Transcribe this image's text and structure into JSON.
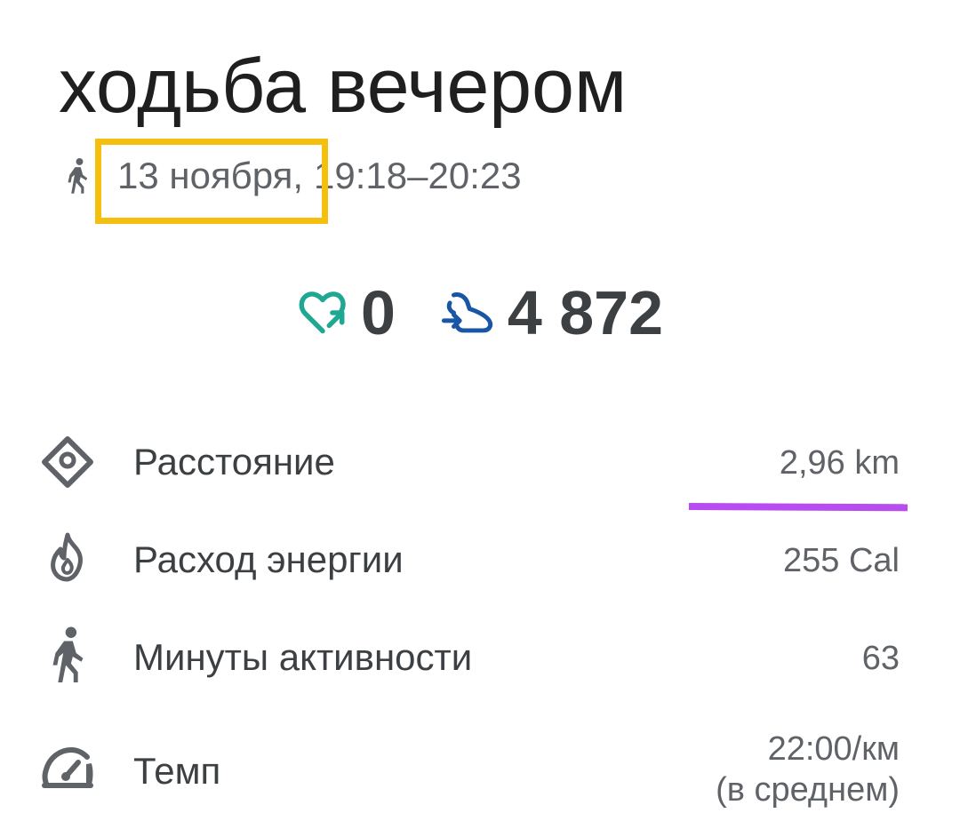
{
  "title": "ходьба вечером",
  "subtitle": {
    "activity_icon": "walking-icon",
    "date": "13 ноября,",
    "time_range": "19:18–20:23"
  },
  "stats": {
    "heart_points": {
      "icon": "heart-points-icon",
      "value": "0",
      "color": "#1ea894"
    },
    "steps": {
      "icon": "steps-icon",
      "value": "4 872",
      "color": "#1a56a6"
    }
  },
  "metrics": [
    {
      "icon": "location-diamond-icon",
      "label": "Расстояние",
      "value": "2,96 km"
    },
    {
      "icon": "flame-icon",
      "label": "Расход энергии",
      "value": "255 Cal"
    },
    {
      "icon": "walking-icon",
      "label": "Минуты активности",
      "value": "63"
    },
    {
      "icon": "speedometer-icon",
      "label": "Темп",
      "value_line1": "22:00/км",
      "value_line2": "(в среднем)"
    }
  ],
  "annotations": {
    "highlight_color": "#f5bf0f",
    "underline_color": "#b84cf0"
  }
}
